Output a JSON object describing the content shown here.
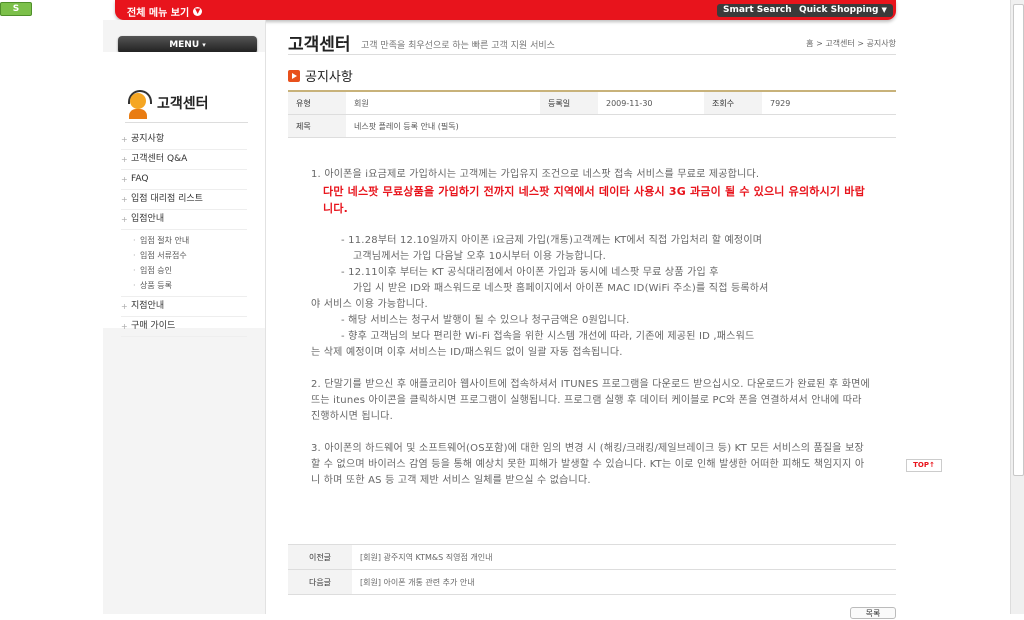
{
  "top": {
    "badge": "S",
    "all_menu": "전체 메뉴 보기",
    "smart_search": "Smart Search",
    "quick_shopping": "Quick Shopping"
  },
  "left": {
    "menu_button": "MENU",
    "title": "고객센터",
    "items": [
      "공지사항",
      "고객센터 Q&A",
      "FAQ",
      "입점 대리점 리스트",
      "입점안내"
    ],
    "sub_items": [
      "입점 절차 안내",
      "입점 서류접수",
      "입점 승인",
      "상품 등록"
    ],
    "items_after": [
      "지점안내",
      "구매 가이드"
    ]
  },
  "header": {
    "title": "고객센터",
    "subtitle": "고객 만족을 최우선으로 하는 빠른 고객 지원 서비스",
    "breadcrumb": "홈 > 고객센터 > 공지사항"
  },
  "section_title": "공지사항",
  "notice": {
    "type_label": "유형",
    "type_value": "회원",
    "date_label": "등록일",
    "date_value": "2009-11-30",
    "views_label": "조회수",
    "views_value": "7929",
    "subject_label": "제목",
    "subject_value": "네스팟 플레이 등록 안내 (필독)"
  },
  "content": {
    "p1": "1. 아이폰을 i요금제로 가입하시는 고객께는 가입유지 조건으로 네스팟 접속 서비스를 무료로 제공합니다.",
    "warning": "다만 네스팟 무료상품을 가입하기 전까지 네스팟 지역에서 데이타 사용시 3G 과금이 될 수 있으니 유의하시기 바랍니다.",
    "b1": "- 11.28부터 12.10일까지 아이폰 i요금제 가입(개통)고객께는 KT에서 직접 가입처리 할 예정이며",
    "b1c": "고객님께서는 가입 다음날 오후 10시부터 이용 가능합니다.",
    "b2": "- 12.11이후 부터는 KT 공식대리점에서 아이폰 가입과 동시에 네스팟 무료 상품 가입 후",
    "b2c": "가입 시 받은 ID와 패스워드로 네스팟 홈페이지에서 아이폰 MAC ID(WiFi 주소)를 직접 등록하셔",
    "b2d": "야 서비스 이용 가능합니다.",
    "b3": "- 해당 서비스는 청구서 발행이 될 수 있으나 청구금액은 0원입니다.",
    "b4": "- 향후 고객님의 보다 편리한 Wi-Fi 접속을 위한 시스템 개선에 따라, 기존에 제공된 ID ,패스워드",
    "b4c": "는 삭제 예정이며  이후 서비스는 ID/패스워드 없이 일괄 자동 접속됩니다.",
    "p2": "2. 단말기를 받으신 후 애플코리아 웹사이트에 접속하셔서 ITUNES 프로그램을 다운로드 받으십시오. 다운로드가 완료된 후 화면에 뜨는 itunes 아이콘을 클릭하시면 프로그램이 실행됩니다. 프로그램 실행 후 데이터 케이블로 PC와 폰을 연결하셔서 안내에 따라 진행하시면 됩니다.",
    "p3": "3. 아이폰의 하드웨어 및 소프트웨어(OS포함)에 대한 임의 변경 시 (해킹/크래킹/제일브레이크 등) KT 모든 서비스의 품질을 보장할  수 없으며 바이러스 감염 등을 통해 예상치 못한 피해가 발생할 수 있습니다.  KT는 이로 인해 발생한 어떠한 피해도 책임지지 아니 하며 또한 AS 등 고객 제반 서비스 일체를 받으실 수 없습니다."
  },
  "nav": {
    "prev_label": "이전글",
    "prev_value": "[회원]  광주지역 KTM&S 직영점 개인내",
    "next_label": "다음글",
    "next_value": "[회원]  아이폰 개통 관련 추가 안내"
  },
  "top_button": "TOP",
  "list_button": "목록"
}
